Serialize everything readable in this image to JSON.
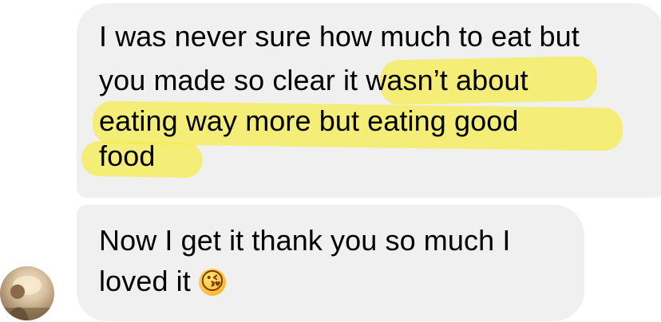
{
  "messages": [
    {
      "lines": [
        "I was never sure how much to eat but",
        "you made so clear it wasn’t about",
        "eating way more but eating good",
        "food"
      ]
    },
    {
      "lines": [
        "Now I get it thank you so much I",
        "loved it"
      ],
      "emoji": "😘"
    }
  ],
  "highlight_color": "#f5ec55",
  "bubble_color": "#f0f0f0"
}
